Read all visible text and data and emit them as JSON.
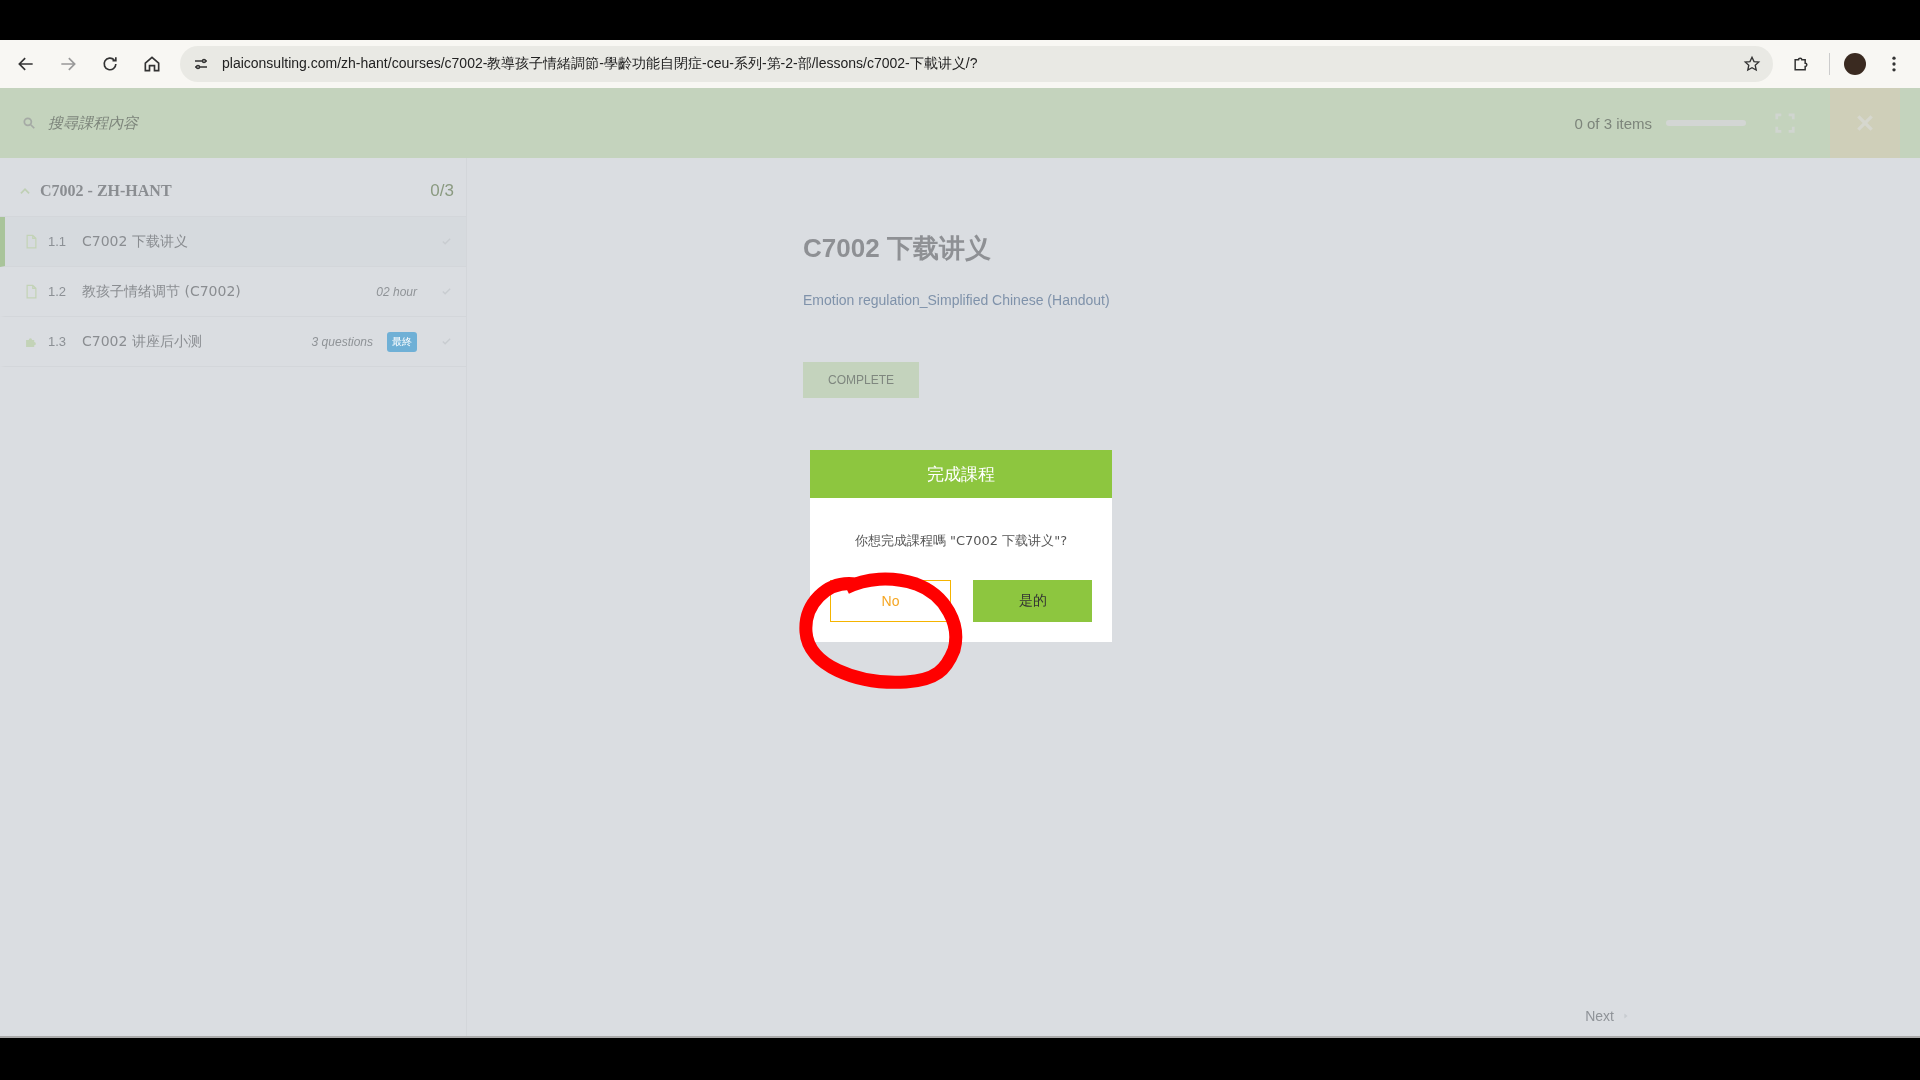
{
  "browser": {
    "url": "plaiconsulting.com/zh-hant/courses/c7002-教導孩子情緒調節-學齡功能自閉症-ceu-系列-第-2-部/lessons/c7002-下載讲义/?"
  },
  "header": {
    "search": {
      "placeholder": "搜尋課程內容"
    },
    "progress_text": "0 of 3 items",
    "level": 0
  },
  "sidebar": {
    "section": {
      "title": "C7002 - ZH-HANT",
      "count": "0/3",
      "expanded": true
    },
    "items": [
      {
        "kind": "document",
        "number": "1.1",
        "title": "C7002 下载讲义",
        "selected": true
      },
      {
        "kind": "document",
        "number": "1.2",
        "title": "教孩子情绪调节 (C7002)",
        "meta": "02 hour",
        "selected": false
      },
      {
        "kind": "quiz",
        "number": "1.3",
        "title": "C7002 讲座后小测",
        "meta": "3 questions",
        "badge": "最終",
        "selected": false
      }
    ]
  },
  "lesson": {
    "title": "C7002 下载讲义",
    "link": "Emotion regulation_Simplified Chinese (Handout)",
    "complete_button": "COMPLETE"
  },
  "dialog": {
    "title": "完成課程",
    "message": "你想完成課程嗎 \"C7002 下载讲义\"?",
    "buttons": [
      {
        "kind": "cancel",
        "label": "No"
      },
      {
        "kind": "confirm",
        "label": "是的"
      }
    ]
  },
  "footer": {
    "next": "Next"
  }
}
